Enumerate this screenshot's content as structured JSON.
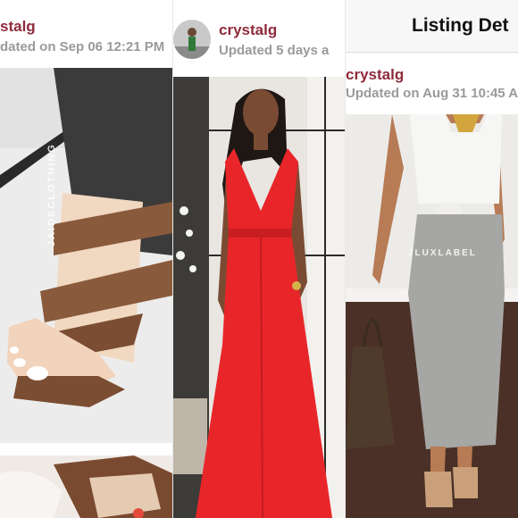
{
  "panels": [
    {
      "username": "stalg",
      "updated": "dated on Sep 06 12:21 PM",
      "watermark": "JAIDECLOTHING"
    },
    {
      "username": "crystalg",
      "updated": "Updated 5 days a"
    },
    {
      "screen_title": "Listing Det",
      "username": "crystalg",
      "updated": "Updated on Aug 31 10:45 A",
      "watermark": "JLUXLABEL"
    }
  ],
  "colors": {
    "username": "#8f2b3b",
    "muted": "#9a9a9a",
    "dress": "#e8262a"
  }
}
